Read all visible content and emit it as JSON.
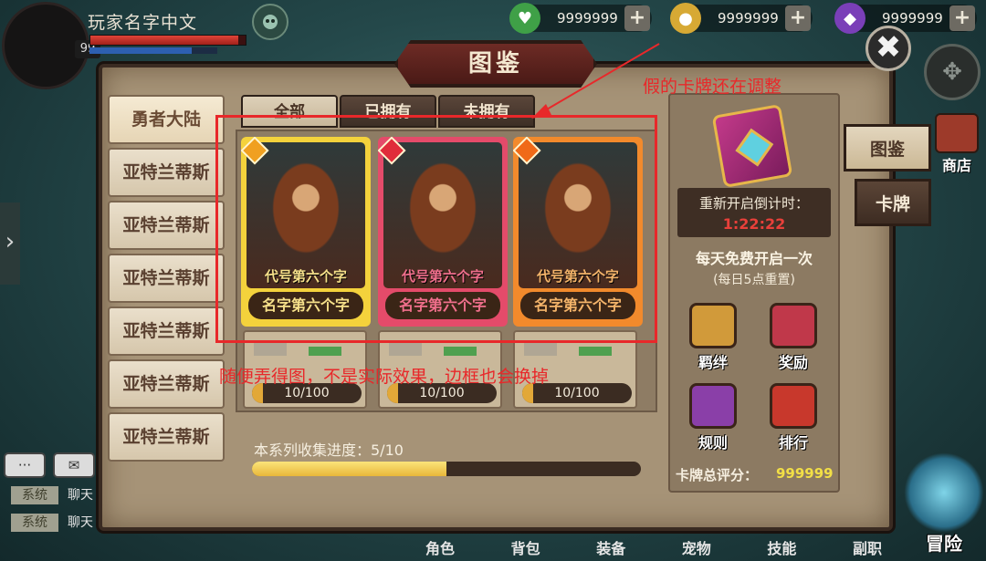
{
  "hud": {
    "player_name": "玩家名字中文",
    "level": "99",
    "hp_fill": 0.95,
    "mp_fill": 0.8,
    "resources": [
      {
        "icon": "green-heart-gem-icon",
        "value": "9999999",
        "color": "#3fa047"
      },
      {
        "icon": "gold-coin-icon",
        "value": "9999999",
        "color": "#d7a934"
      },
      {
        "icon": "purple-diamond-icon",
        "value": "9999999",
        "color": "#7a3fb8"
      }
    ],
    "plus": "+"
  },
  "panel": {
    "title": "图鉴",
    "close": "✖"
  },
  "categories": [
    "勇者大陆",
    "亚特兰蒂斯",
    "亚特兰蒂斯",
    "亚特兰蒂斯",
    "亚特兰蒂斯",
    "亚特兰蒂斯",
    "亚特兰蒂斯"
  ],
  "tabs": [
    "全部",
    "已拥有",
    "未拥有"
  ],
  "cards": [
    {
      "codename": "代号第六个字",
      "name": "名字第六个字",
      "frame": "#f4d23c",
      "name_color": "#f6e08a",
      "gem": "#f0a020"
    },
    {
      "codename": "代号第六个字",
      "name": "名字第六个字",
      "frame": "#e44b6a",
      "name_color": "#f06f8c",
      "gem": "#e02c3a"
    },
    {
      "codename": "代号第六个字",
      "name": "名字第六个字",
      "frame": "#f28a2c",
      "name_color": "#f4b46a",
      "gem": "#f06a18"
    }
  ],
  "progress_slots": [
    {
      "text": "10/100",
      "fill": 0.1
    },
    {
      "text": "10/100",
      "fill": 0.1
    },
    {
      "text": "10/100",
      "fill": 0.1
    }
  ],
  "collection": {
    "label": "本系列收集进度：5/10",
    "fill": 0.5
  },
  "right": {
    "countdown_label": "重新开启倒计时：",
    "countdown_time": "1:22:22",
    "free_open": "每天免费开启一次",
    "reset_note": "(每日5点重置)",
    "buttons": [
      "羁绊",
      "奖励",
      "规则",
      "排行"
    ],
    "score_label": "卡牌总评分：",
    "score_value": "999999"
  },
  "side_tabs": {
    "pokedex": "图鉴",
    "cards": "卡牌",
    "shop": "商店"
  },
  "chat": {
    "messages": [
      {
        "tag": "系统",
        "text": "聊天"
      },
      {
        "tag": "系统",
        "text": "聊天"
      }
    ]
  },
  "bottom_nav": [
    "角色",
    "背包",
    "装备",
    "宠物",
    "技能",
    "副职"
  ],
  "adventure": "冒险",
  "annotations": {
    "top": "假的卡牌还在调整",
    "bottom": "随便弄得图，不是实际效果，边框也会换掉"
  }
}
